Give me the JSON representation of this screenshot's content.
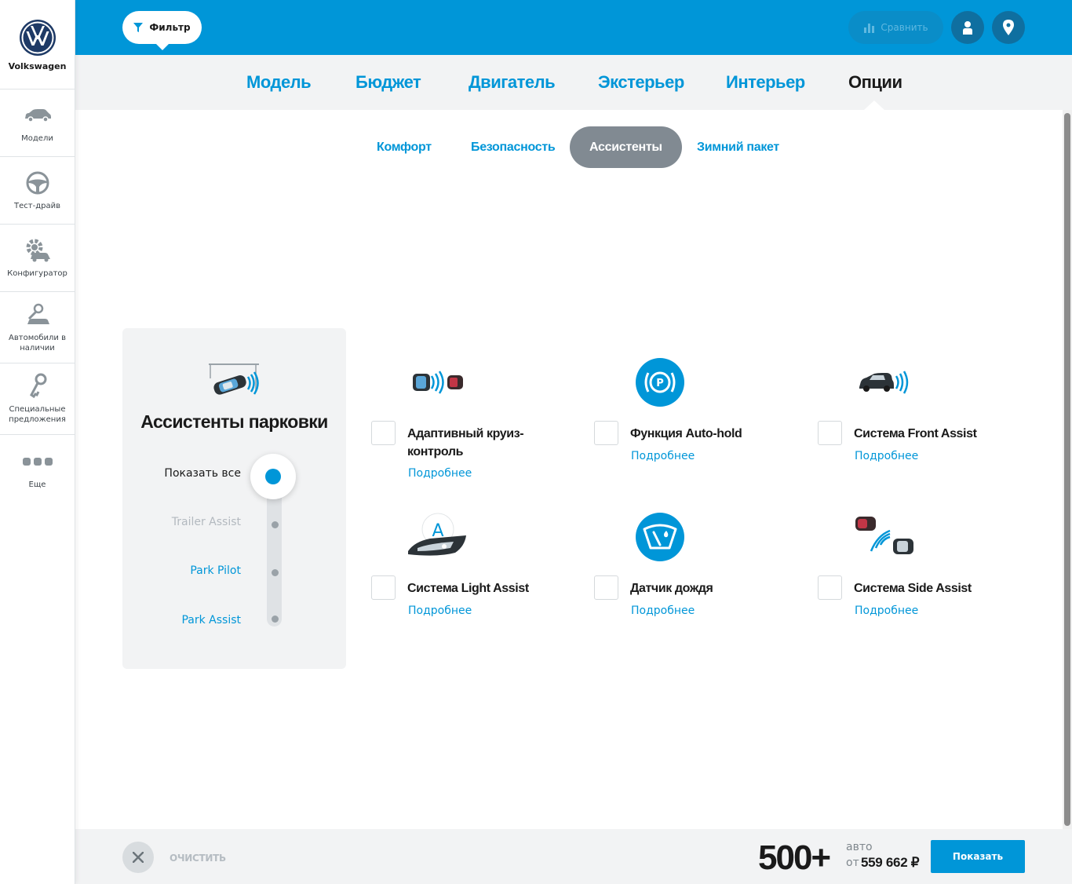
{
  "brand": {
    "name": "Volkswagen",
    "logo_icon": "vw-logo-icon"
  },
  "sidebar": {
    "items": [
      {
        "label": "Модели",
        "icon": "car-icon"
      },
      {
        "label": "Тест-драйв",
        "icon": "steering-wheel-icon"
      },
      {
        "label": "Конфигуратор",
        "icon": "gear-car-icon"
      },
      {
        "label": "Автомобили в наличии",
        "icon": "car-key-icon"
      },
      {
        "label": "Специальные предложения",
        "icon": "keys-icon"
      },
      {
        "label": "Еще",
        "icon": "more-dots-icon"
      }
    ]
  },
  "header": {
    "filter_label": "Фильтр",
    "compare_label": "Сравнить",
    "user_icon": "user-icon",
    "location_icon": "location-pin-icon"
  },
  "tabs": {
    "items": [
      {
        "label": "Модель",
        "active": false
      },
      {
        "label": "Бюджет",
        "active": false
      },
      {
        "label": "Двигатель",
        "active": false
      },
      {
        "label": "Экстерьер",
        "active": false
      },
      {
        "label": "Интерьер",
        "active": false
      },
      {
        "label": "Опции",
        "active": true
      }
    ]
  },
  "subtabs": {
    "items": [
      {
        "label": "Комфорт",
        "active": false
      },
      {
        "label": "Безопасность",
        "active": false
      },
      {
        "label": "Ассистенты",
        "active": true
      },
      {
        "label": "Зимний пакет",
        "active": false
      }
    ]
  },
  "parking": {
    "title": "Ассистенты парковки",
    "options": [
      {
        "label": "Показать все",
        "state": "selected"
      },
      {
        "label": "Trailer Assist",
        "state": "disabled"
      },
      {
        "label": "Park Pilot",
        "state": "available"
      },
      {
        "label": "Park Assist",
        "state": "available"
      }
    ]
  },
  "options": {
    "more_label": "Подробнее",
    "items": [
      {
        "label": "Адаптивный круиз-контроль",
        "icon": "adaptive-cruise-icon",
        "checked": false
      },
      {
        "label": "Функция Auto-hold",
        "icon": "parking-brake-icon",
        "checked": false
      },
      {
        "label": "Система Front Assist",
        "icon": "front-assist-icon",
        "checked": false
      },
      {
        "label": "Система Light Assist",
        "icon": "headlight-icon",
        "checked": false
      },
      {
        "label": "Датчик дождя",
        "icon": "rain-sensor-icon",
        "checked": false
      },
      {
        "label": "Система Side Assist",
        "icon": "side-assist-icon",
        "checked": false
      }
    ]
  },
  "footer": {
    "clear_label": "ОЧИСТИТЬ",
    "count": "500+",
    "count_unit": "авто",
    "price_prefix": "от",
    "price": "559 662 ₽",
    "show_label": "Показать"
  },
  "colors": {
    "accent": "#0096d8",
    "active_tab_bg": "#818a92",
    "panel_bg": "#f2f3f4",
    "text": "#1a1a1a"
  }
}
